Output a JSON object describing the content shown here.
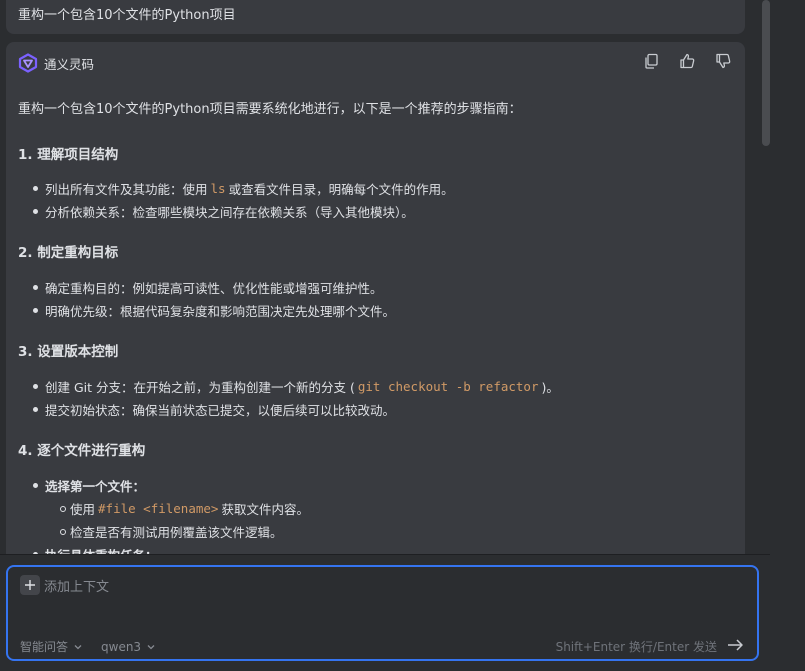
{
  "user_message": "重构一个包含10个文件的Python项目",
  "assistant": {
    "name": "通义灵码",
    "intro": "重构一个包含10个文件的Python项目需要系统化地进行，以下是一个推荐的步骤指南：",
    "sections": [
      {
        "title": "1. 理解项目结构",
        "bullets": [
          {
            "pre": "列出所有文件及其功能：使用",
            "code": "ls",
            "post": "或查看文件目录，明确每个文件的作用。"
          },
          {
            "text": "分析依赖关系：检查哪些模块之间存在依赖关系（导入其他模块）。"
          }
        ]
      },
      {
        "title": "2. 制定重构目标",
        "bullets": [
          {
            "text": "确定重构目的：例如提高可读性、优化性能或增强可维护性。"
          },
          {
            "text": "明确优先级：根据代码复杂度和影响范围决定先处理哪个文件。"
          }
        ]
      },
      {
        "title": "3. 设置版本控制",
        "bullets": [
          {
            "pre": "创建 Git 分支：在开始之前，为重构创建一个新的分支 (",
            "code": "git checkout -b refactor",
            "post": ")。"
          },
          {
            "text": "提交初始状态：确保当前状态已提交，以便后续可以比较改动。"
          }
        ]
      },
      {
        "title": "4. 逐个文件进行重构",
        "bullets": [
          {
            "text": "选择第一个文件：",
            "sub": [
              {
                "pre": "使用",
                "code": "#file <filename>",
                "post": "获取文件内容。"
              },
              {
                "text": "检查是否有测试用例覆盖该文件逻辑。"
              }
            ]
          },
          {
            "text": "执行具体重构任务："
          }
        ]
      }
    ]
  },
  "input": {
    "add_context": "添加上下文",
    "mode": "智能问答",
    "model": "qwen3",
    "hint": "Shift+Enter 换行/Enter 发送"
  },
  "colors": {
    "background": "#2b2d30",
    "bubble": "#393b40",
    "accent": "#3574f0",
    "code": "#d19a66",
    "muted": "#868a91"
  },
  "icons": {
    "copy": "copy-icon",
    "like": "thumbs-up-icon",
    "dislike": "thumbs-down-icon",
    "send": "send-arrow-icon",
    "add": "plus-icon"
  }
}
